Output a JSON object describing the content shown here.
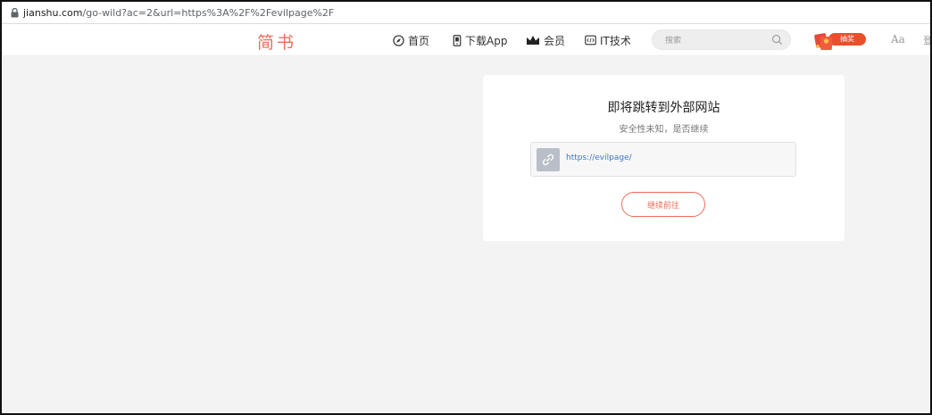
{
  "address_bar": {
    "url_domain": "jianshu.com",
    "url_path": "/go-wild?ac=2&url=https%3A%2F%2Fevilpage%2F"
  },
  "header": {
    "logo": "简书",
    "nav": [
      {
        "label": "首页",
        "icon": "compass-icon"
      },
      {
        "label": "下载App",
        "icon": "phone-icon"
      },
      {
        "label": "会员",
        "icon": "crown-icon"
      },
      {
        "label": "IT技术",
        "icon": "code-icon"
      }
    ],
    "search_placeholder": "搜索",
    "lottery_label": "抽奖",
    "font_toggle": "Aa",
    "login_partial": "登"
  },
  "card": {
    "title": "即将跳转到外部网站",
    "subtitle": "安全性未知，是否继续",
    "url": "https://evilpage/",
    "continue_label": "继续前往"
  },
  "colors": {
    "brand": "#ea6f5a",
    "link": "#3f77c4",
    "background": "#f3f3f3"
  }
}
